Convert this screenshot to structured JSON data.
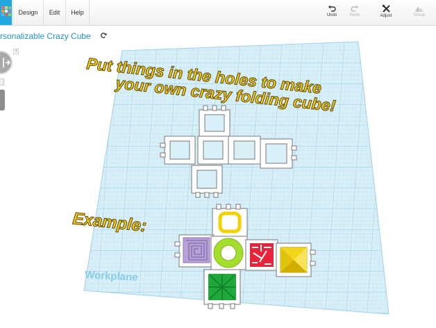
{
  "menubar": {
    "items": [
      {
        "label": "Design",
        "name": "menu-design"
      },
      {
        "label": "Edit",
        "name": "menu-edit"
      },
      {
        "label": "Help",
        "name": "menu-help"
      }
    ]
  },
  "toolbar": {
    "undo_label": "Undo",
    "redo_label": "Redo",
    "adjust_label": "Adjust",
    "group_label": "Group"
  },
  "project": {
    "title": "rsonalizable Crazy Cube"
  },
  "controls": {
    "help_label": "?"
  },
  "workplane": {
    "label": "Workplane",
    "grid_color": "#9fd4ee",
    "plane_color": "#d9eff8"
  },
  "overlay": {
    "line1": "Put things in the holes to make",
    "line2": "your own crazy folding cube!",
    "example_label": "Example:",
    "text_color": "#f3cf24",
    "outline_color": "#6a5100"
  },
  "accent": {
    "brand": "#20a8de",
    "title": "#1e95c8"
  },
  "icons": {
    "logo": "tinkercad-logo-icon",
    "undo": "undo-icon",
    "redo": "redo-icon",
    "adjust": "adjust-icon",
    "group": "group-icon",
    "refresh": "refresh-icon"
  }
}
